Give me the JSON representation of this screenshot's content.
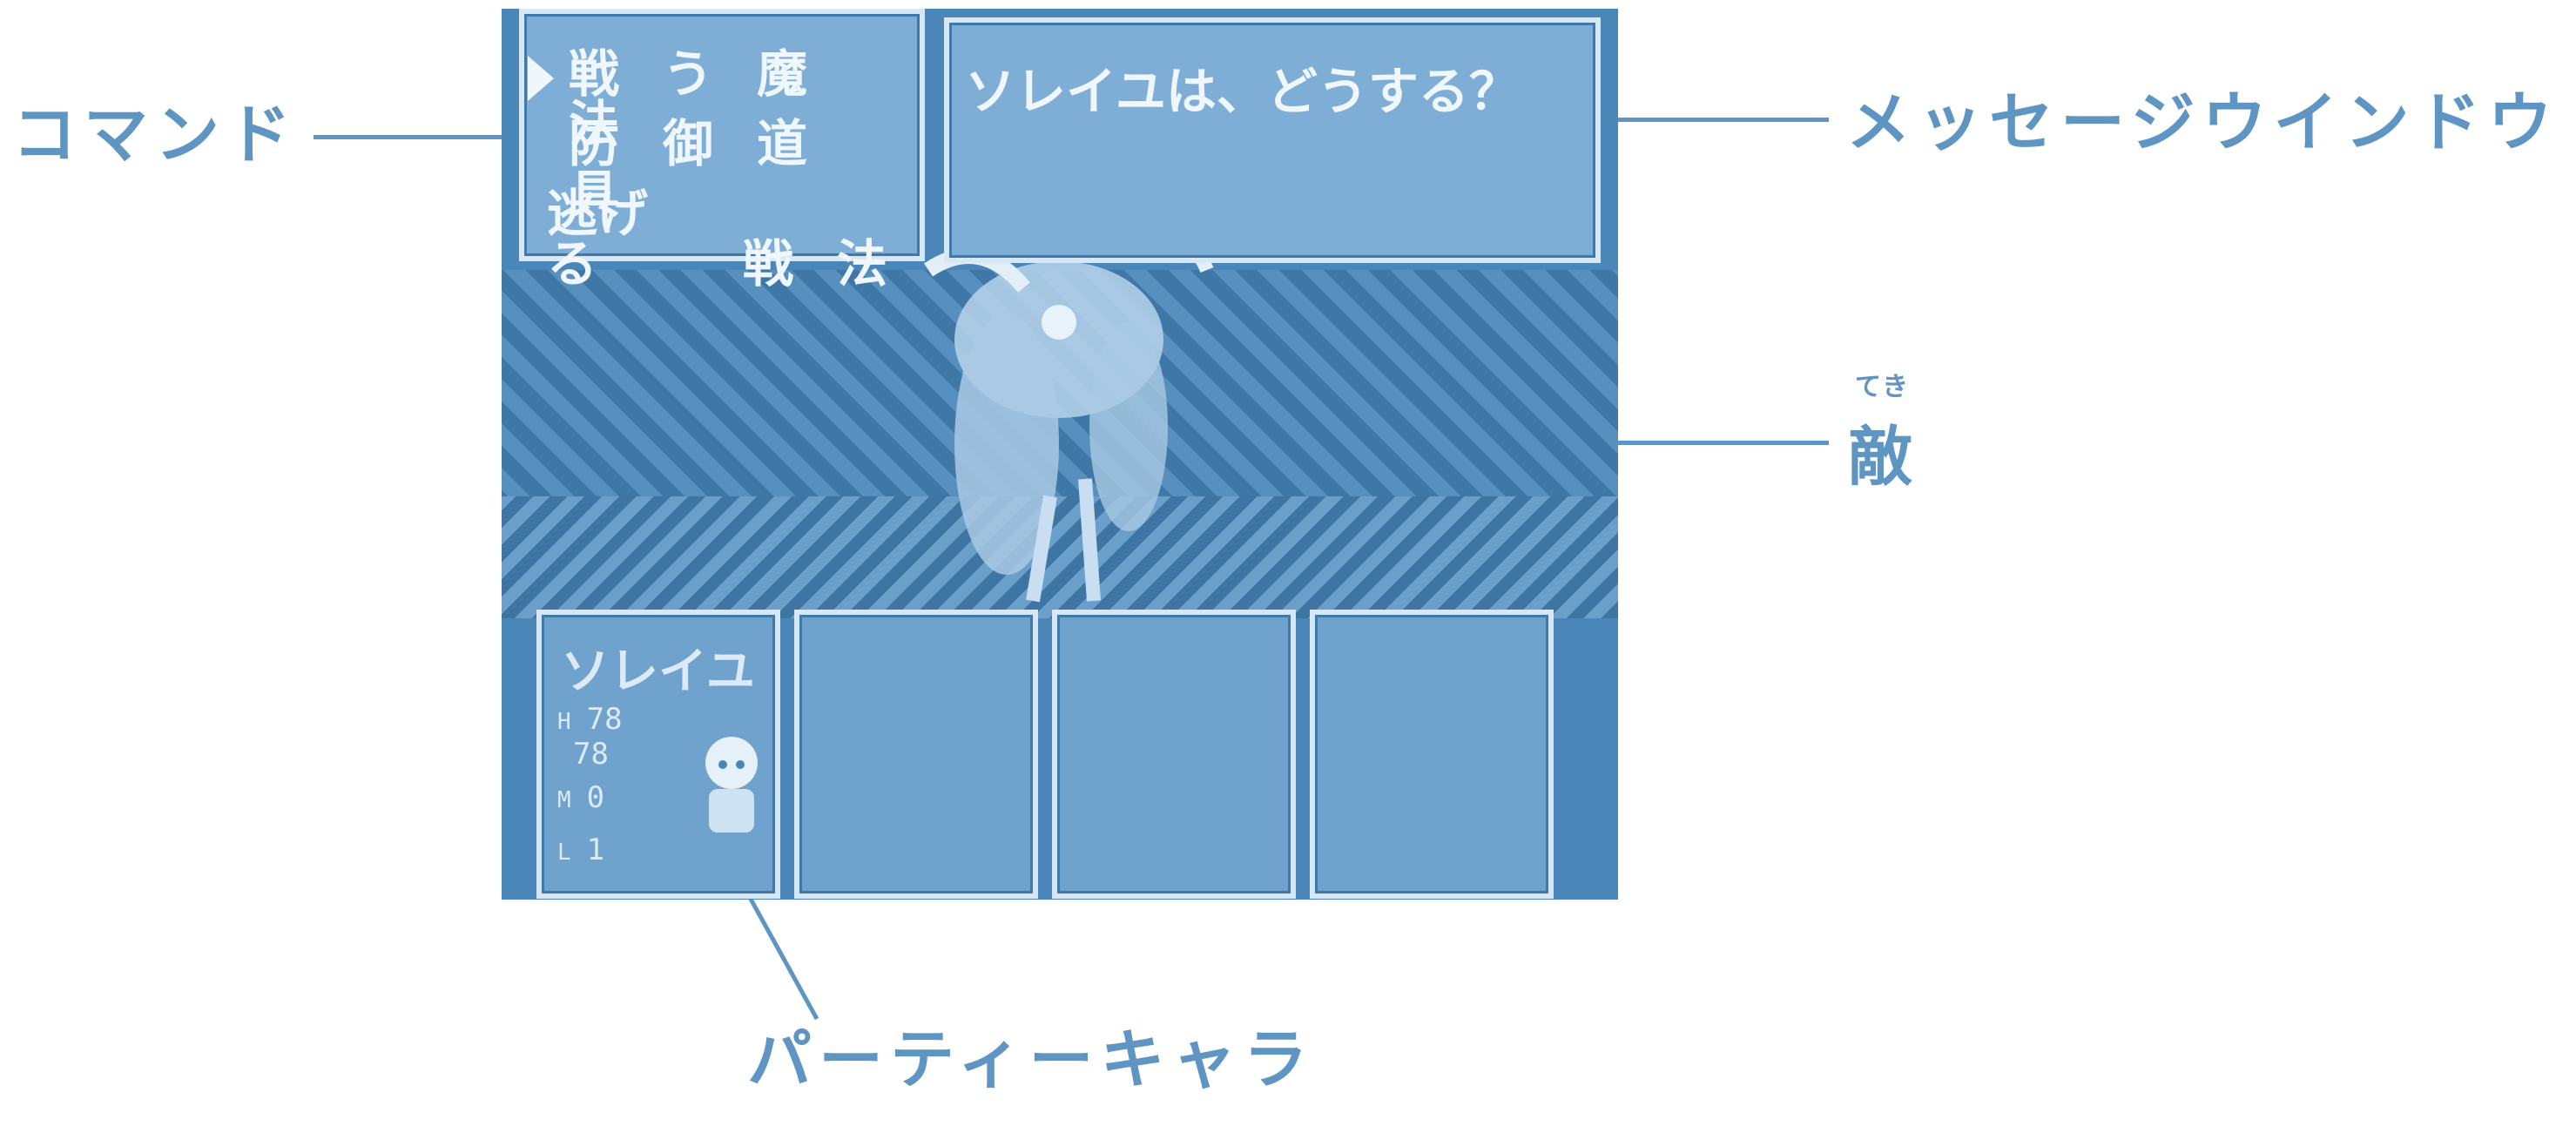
{
  "labels": {
    "command": "コマンド",
    "message_window": "メッセージウインドウ",
    "enemy": "敵",
    "enemy_ruby": "てき",
    "party_chara": "パーティーキャラ"
  },
  "command_menu": {
    "rows": [
      [
        "戦",
        "う",
        "魔",
        "法"
      ],
      [
        "防",
        "御",
        "道",
        "具"
      ],
      [
        "逃げる",
        "戦",
        "法"
      ]
    ]
  },
  "message": "ソレイユは、どうする？",
  "party": [
    {
      "name": "ソレイユ",
      "stats": [
        {
          "label": "H",
          "value": "78"
        },
        {
          "label": "",
          "value": "78"
        },
        {
          "label": "M",
          "value": "0"
        },
        {
          "label": "L",
          "value": "1"
        }
      ]
    }
  ],
  "colors": {
    "accent": "#5f95c3",
    "screen": "#4a86b8",
    "panel": "#7eaed5"
  }
}
